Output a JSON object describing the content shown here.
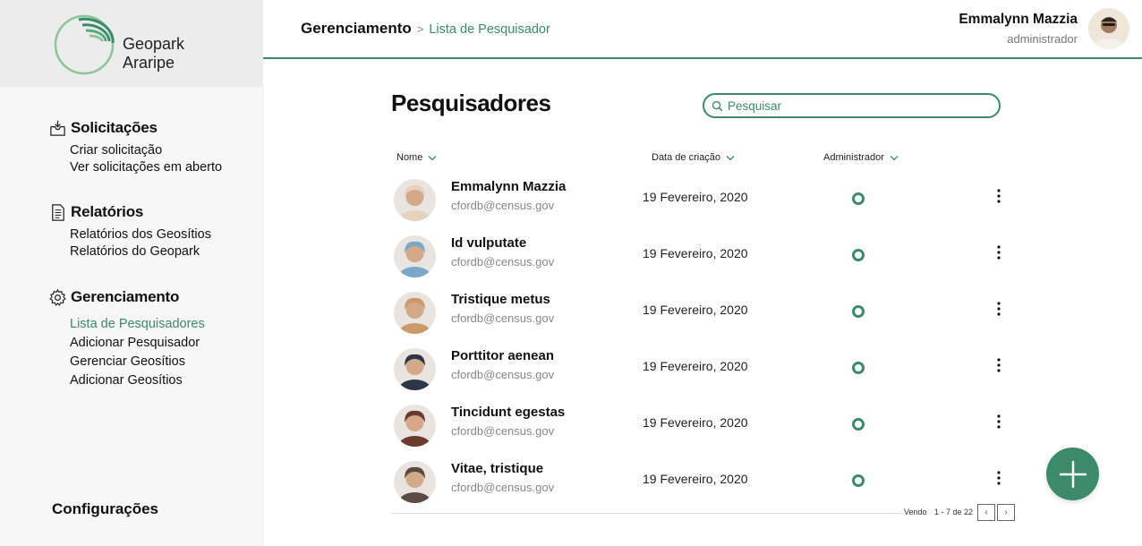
{
  "brand": {
    "line1": "Geopark",
    "line2": "Araripe",
    "accent": "#3d8a6a"
  },
  "sidebar": {
    "sections": [
      {
        "title": "Solicitações",
        "icon": "inbox-icon",
        "items": [
          {
            "label": "Criar solicitação",
            "active": false
          },
          {
            "label": "Ver solicitações em aberto",
            "active": false
          }
        ]
      },
      {
        "title": "Relatórios",
        "icon": "document-icon",
        "items": [
          {
            "label": "Relatórios dos Geosítios",
            "active": false
          },
          {
            "label": "Relatórios do Geopark",
            "active": false
          }
        ]
      },
      {
        "title": "Gerenciamento",
        "icon": "gear-icon",
        "items": [
          {
            "label": "Lista de Pesquisadores",
            "active": true
          },
          {
            "label": "Adicionar Pesquisador",
            "active": false
          },
          {
            "label": "Gerenciar Geosítios",
            "active": false
          },
          {
            "label": "Adicionar Geosítios",
            "active": false
          }
        ]
      }
    ],
    "settings_label": "Configurações"
  },
  "header": {
    "breadcrumb_main": "Gerenciamento",
    "breadcrumb_sep": ">",
    "breadcrumb_sub": "Lista de Pesquisador",
    "user_name": "Emmalynn Mazzia",
    "user_role": "administrador"
  },
  "main": {
    "title": "Pesquisadores",
    "search_placeholder": "Pesquisar",
    "columns": {
      "name": "Nome",
      "date": "Data de criação",
      "admin": "Administrador"
    },
    "rows": [
      {
        "name": "Emmalynn Mazzia",
        "email": "cfordb@census.gov",
        "date": "19 Fevereiro, 2020",
        "admin": false,
        "avatar_color": "#e6d2c0"
      },
      {
        "name": "Id vulputate",
        "email": "cfordb@census.gov",
        "date": "19 Fevereiro, 2020",
        "admin": false,
        "avatar_color": "#7aa6c8"
      },
      {
        "name": "Tristique metus",
        "email": "cfordb@census.gov",
        "date": "19 Fevereiro, 2020",
        "admin": false,
        "avatar_color": "#c99a6a"
      },
      {
        "name": "Porttitor aenean",
        "email": "cfordb@census.gov",
        "date": "19 Fevereiro, 2020",
        "admin": false,
        "avatar_color": "#2d3648"
      },
      {
        "name": "Tincidunt egestas",
        "email": "cfordb@census.gov",
        "date": "19 Fevereiro, 2020",
        "admin": false,
        "avatar_color": "#6b3a2e"
      },
      {
        "name": "Vitae, tristique",
        "email": "cfordb@census.gov",
        "date": "19 Fevereiro, 2020",
        "admin": false,
        "avatar_color": "#5a4a44"
      }
    ],
    "pager": {
      "label": "Vendo",
      "count": "1 - 7 de 22",
      "prev": "‹",
      "next": "›"
    }
  }
}
